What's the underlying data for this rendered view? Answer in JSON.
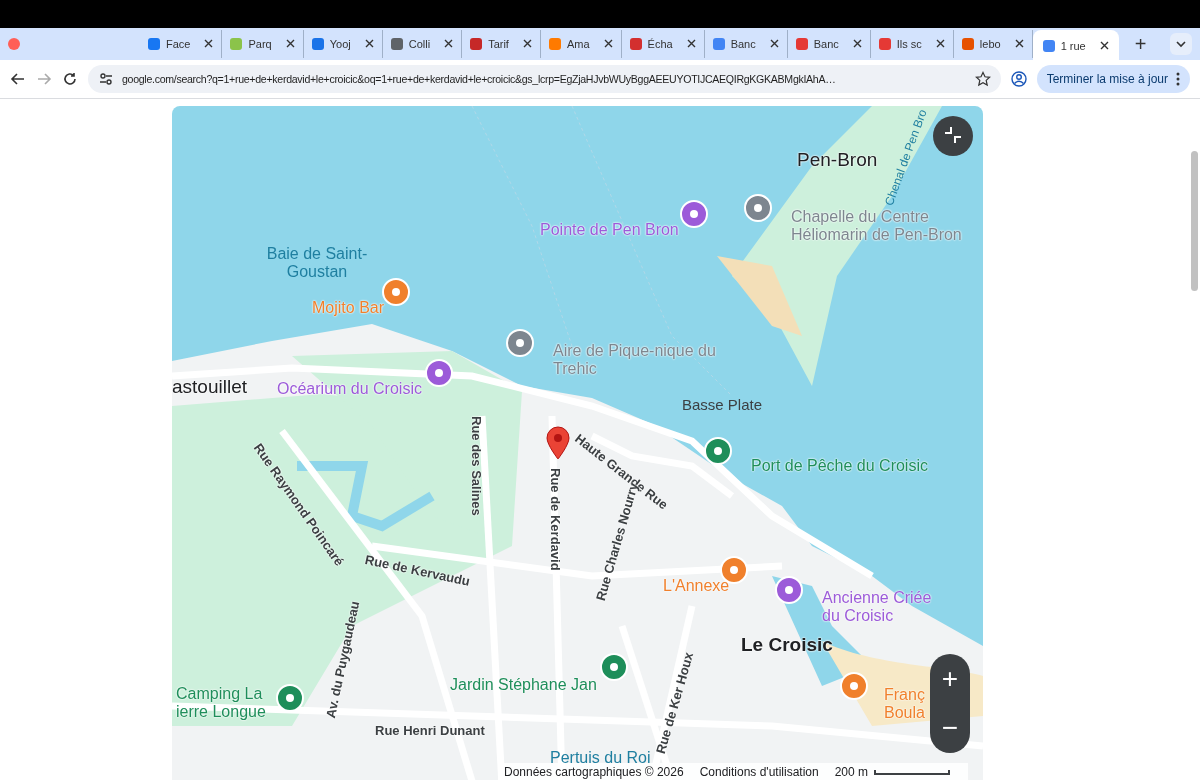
{
  "browser": {
    "tabs": [
      {
        "title": "Face",
        "selected": false
      },
      {
        "title": "Parq",
        "selected": false
      },
      {
        "title": "Yooj",
        "selected": false
      },
      {
        "title": "Colli",
        "selected": false
      },
      {
        "title": "Tarif",
        "selected": false
      },
      {
        "title": "Ama",
        "selected": false
      },
      {
        "title": "Écha",
        "selected": false
      },
      {
        "title": "Banc",
        "selected": false
      },
      {
        "title": "Banc",
        "selected": false
      },
      {
        "title": "Ils sc",
        "selected": false
      },
      {
        "title": "lebo",
        "selected": false
      },
      {
        "title": "1 rue",
        "selected": true
      }
    ],
    "new_tab": "+",
    "address": "google.com/search?q=1+rue+de+kerdavid+le+croicic&oq=1+rue+de+kerdavid+le+croicic&gs_lcrp=EgZjaHJvbWUyBggAEEUYOTIJCAEQIRgKGKABMgkIAhA…",
    "update_button": "Terminer la mise à jour"
  },
  "map": {
    "labels": [
      {
        "text": "Pen-Bron",
        "kind": "place"
      },
      {
        "text": "Chenal de Pen Bro",
        "kind": "water"
      },
      {
        "text": "Pointe de Pen Bron",
        "kind": "poi",
        "color": "#9c5bd9"
      },
      {
        "text": "Chapelle du Centre Héliomarin de Pen-Bron",
        "kind": "poi",
        "color": "#7d868f"
      },
      {
        "text": "Baie de Saint-Goustan",
        "kind": "water"
      },
      {
        "text": "Mojito Bar",
        "kind": "poi",
        "color": "#f0802c"
      },
      {
        "text": "Aire de Pique-nique du Trehic",
        "kind": "poi",
        "color": "#7d868f"
      },
      {
        "text": "astouillet",
        "kind": "place"
      },
      {
        "text": "Océarium du Croisic",
        "kind": "poi",
        "color": "#9c5bd9"
      },
      {
        "text": "Basse Plate",
        "kind": "area"
      },
      {
        "text": "Rue des Salines",
        "kind": "street"
      },
      {
        "text": "Rue de Kerdavid",
        "kind": "street"
      },
      {
        "text": "Haute Grande Rue",
        "kind": "street"
      },
      {
        "text": "Port de Pêche du Croisic",
        "kind": "poi",
        "color": "#1e8e5a"
      },
      {
        "text": "Rue Raymond Poincaré",
        "kind": "street"
      },
      {
        "text": "Rue de Kervaudu",
        "kind": "street"
      },
      {
        "text": "Rue Charles Nourry",
        "kind": "street"
      },
      {
        "text": "L'Annexe",
        "kind": "poi",
        "color": "#f0802c"
      },
      {
        "text": "Ancienne Criée du Croisic",
        "kind": "poi",
        "color": "#9c5bd9"
      },
      {
        "text": "Le Croisic",
        "kind": "town"
      },
      {
        "text": "Av. du Puygaudeau",
        "kind": "street"
      },
      {
        "text": "Camping La ierre Longue",
        "kind": "poi",
        "color": "#1e8e5a"
      },
      {
        "text": "Jardin Stéphane Jan",
        "kind": "poi",
        "color": "#1e8e5a"
      },
      {
        "text": "Rue de Ker Houx",
        "kind": "street"
      },
      {
        "text": "Franç Boula",
        "kind": "poi",
        "color": "#f0802c"
      },
      {
        "text": "Rue Henri Dunant",
        "kind": "street"
      },
      {
        "text": "Pertuis du Roi",
        "kind": "water"
      }
    ],
    "zoom_in": "+",
    "zoom_out": "−",
    "attribution": "Données cartographiques © 2026",
    "terms": "Conditions d'utilisation",
    "scale": "200 m"
  }
}
